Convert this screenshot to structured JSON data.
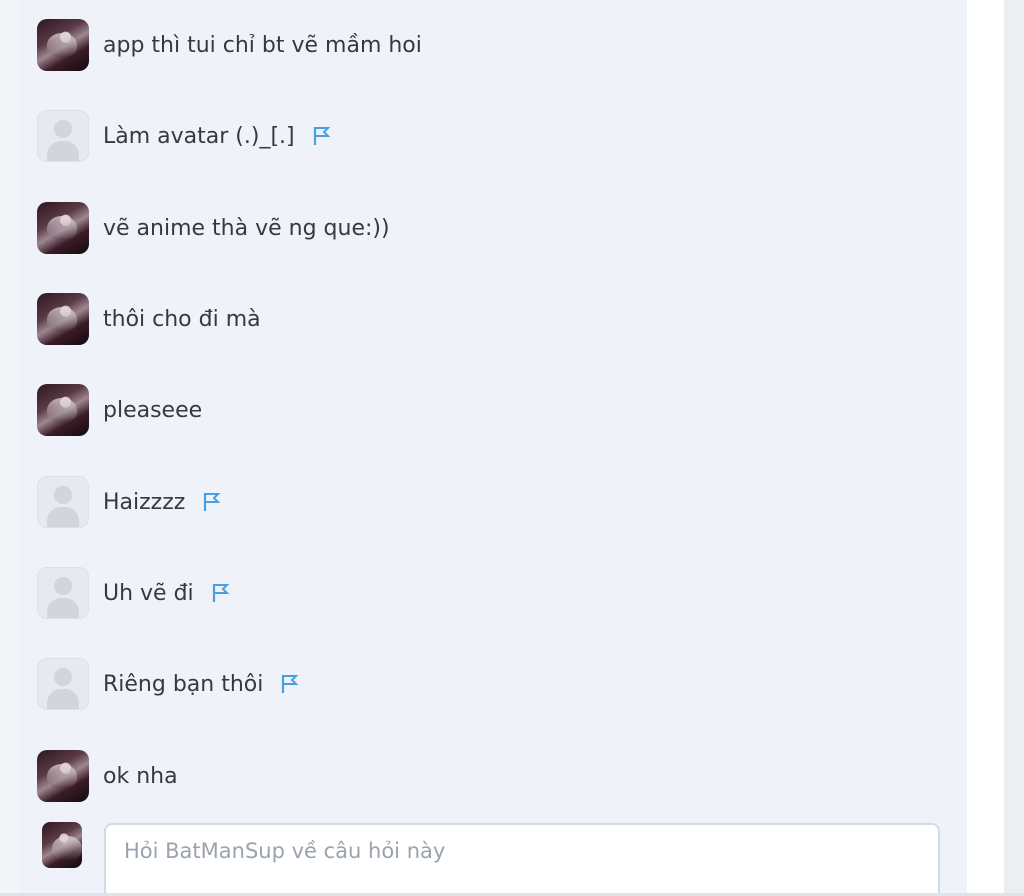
{
  "comments": [
    {
      "text": "app thì tui chỉ bt vẽ mầm hoi",
      "avatar": "user-photo-avatar",
      "flag": false
    },
    {
      "text": "Làm avatar (.)_[.]",
      "avatar": "default-avatar",
      "flag": true
    },
    {
      "text": "vẽ anime thà vẽ ng que:))",
      "avatar": "user-photo-avatar",
      "flag": false
    },
    {
      "text": "thôi cho đi mà",
      "avatar": "user-photo-avatar",
      "flag": false
    },
    {
      "text": "pleaseee",
      "avatar": "user-photo-avatar",
      "flag": false
    },
    {
      "text": "Haizzzz",
      "avatar": "default-avatar",
      "flag": true
    },
    {
      "text": "Uh vẽ đi",
      "avatar": "default-avatar",
      "flag": true
    },
    {
      "text": "Riêng bạn thôi",
      "avatar": "default-avatar",
      "flag": true
    },
    {
      "text": "ok nha",
      "avatar": "user-photo-avatar",
      "flag": false
    }
  ],
  "composer": {
    "placeholder": "Hỏi BatManSup về câu hỏi này",
    "value": ""
  },
  "colors": {
    "panel_bg": "#eff3f9",
    "text": "#333a42",
    "flag": "#4a9fe0",
    "placeholder": "#9aa3ad"
  },
  "icons": {
    "flag": "flag-icon",
    "default_avatar": "user-silhouette-icon"
  }
}
